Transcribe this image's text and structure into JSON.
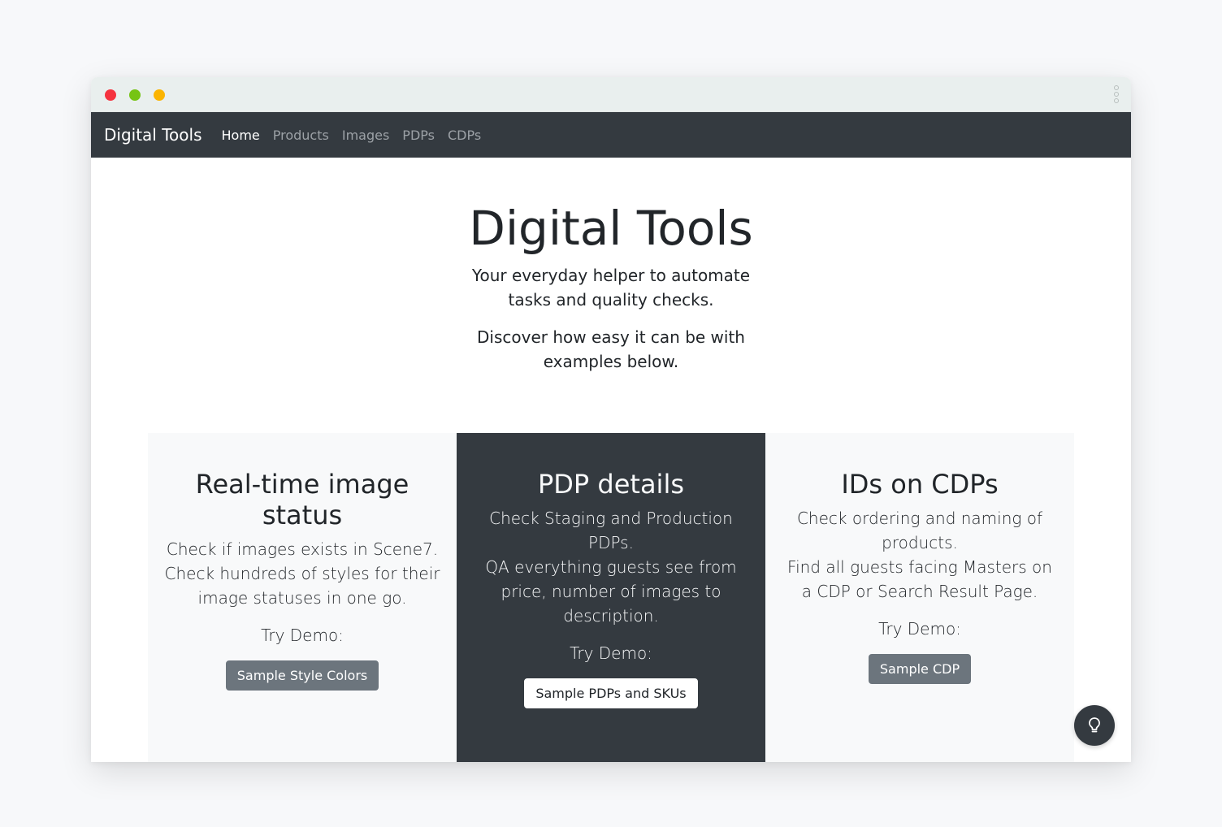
{
  "window": {
    "traffic_lights": [
      "close",
      "minimize",
      "zoom"
    ]
  },
  "navbar": {
    "brand": "Digital Tools",
    "links": [
      {
        "label": "Home",
        "active": true
      },
      {
        "label": "Products",
        "active": false
      },
      {
        "label": "Images",
        "active": false
      },
      {
        "label": "PDPs",
        "active": false
      },
      {
        "label": "CDPs",
        "active": false
      }
    ]
  },
  "hero": {
    "title": "Digital Tools",
    "lead": "Your everyday helper to automate tasks and quality checks.",
    "lead2": "Discover how easy it can be with examples below."
  },
  "features": [
    {
      "title": "Real-time image status",
      "desc_lines": [
        "Check if images exists in Scene7.",
        "Check hundreds of styles for their image statuses in one go."
      ],
      "try_label": "Try Demo:",
      "button_label": "Sample Style Colors"
    },
    {
      "title": "PDP details",
      "desc_lines": [
        "Check Staging and Production PDPs.",
        "QA everything guests see from price, number of images to description."
      ],
      "try_label": "Try Demo:",
      "button_label": "Sample PDPs and SKUs"
    },
    {
      "title": "IDs on CDPs",
      "desc_lines": [
        "Check ordering and naming of products.",
        "Find all guests facing Masters on a CDP or Search Result Page."
      ],
      "try_label": "Try Demo:",
      "button_label": "Sample CDP"
    }
  ],
  "floating": {
    "icon": "lightbulb-icon"
  },
  "colors": {
    "navbar_bg": "#343a40",
    "page_bg": "#f7f8fa",
    "secondary_button": "#6c757d",
    "traffic_red": "#f5333f",
    "traffic_green": "#76c414",
    "traffic_yellow": "#fbb400"
  }
}
